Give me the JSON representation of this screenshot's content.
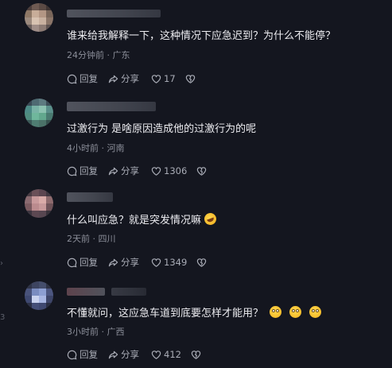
{
  "edge_marks": [
    "›",
    "3"
  ],
  "colors": {
    "background": "#14161f",
    "text_primary": "#ececf0",
    "text_secondary": "#8b8e99",
    "icon": "#a9acb6"
  },
  "action_labels": {
    "reply": "回复",
    "share": "分享"
  },
  "icons": {
    "reply": "reply-bubble-icon",
    "share": "share-arrow-icon",
    "like": "heart-icon",
    "dislike": "broken-heart-icon",
    "emoji_flushed": "flushed-face-emoji",
    "emoji_laugh": "rolling-laughing-emoji"
  },
  "comments": [
    {
      "text": "谁来给我解释一下，这种情况下应急迟到？为什么不能停？",
      "meta": "24分钟前 · 广东",
      "likes": "17"
    },
    {
      "text": "过激行为 是啥原因造成他的过激行为的呢",
      "meta": "4小时前 · 河南",
      "likes": "1306"
    },
    {
      "text": "什么叫应急？就是突发情况嘛",
      "meta": "2天前 · 四川",
      "likes": "1349"
    },
    {
      "text": "不懂就问，这应急车道到底要怎样才能用？",
      "meta": "3小时前 · 广西",
      "likes": "412"
    }
  ]
}
